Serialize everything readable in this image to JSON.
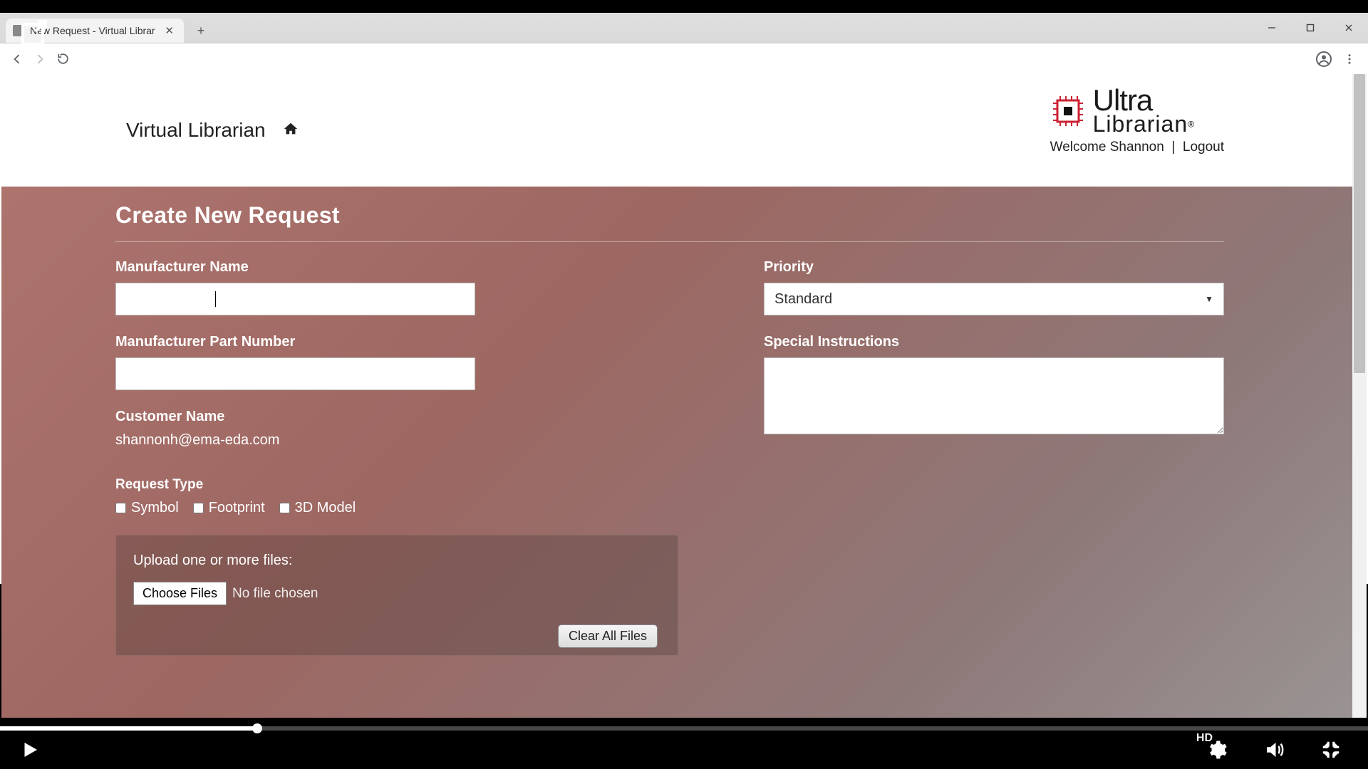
{
  "browser": {
    "tab_title": "New Request - Virtual Librar"
  },
  "header": {
    "brand": "Virtual Librarian",
    "logo_main": "Ultra",
    "logo_sub": "Librarian",
    "welcome": "Welcome Shannon",
    "separator": "|",
    "logout": "Logout"
  },
  "page": {
    "title": "Create New Request"
  },
  "form": {
    "mfr_name_label": "Manufacturer Name",
    "mfr_name_value": "",
    "mfr_part_label": "Manufacturer Part Number",
    "mfr_part_value": "",
    "customer_label": "Customer Name",
    "customer_value": "shannonh@ema-eda.com",
    "request_type_label": "Request Type",
    "type_symbol": "Symbol",
    "type_footprint": "Footprint",
    "type_3d": "3D Model",
    "priority_label": "Priority",
    "priority_value": "Standard",
    "special_label": "Special Instructions",
    "special_value": "",
    "upload_label": "Upload one or more files:",
    "choose_files": "Choose Files",
    "no_file": "No file chosen",
    "clear_all": "Clear All Files"
  },
  "player": {
    "hd": "HD"
  }
}
